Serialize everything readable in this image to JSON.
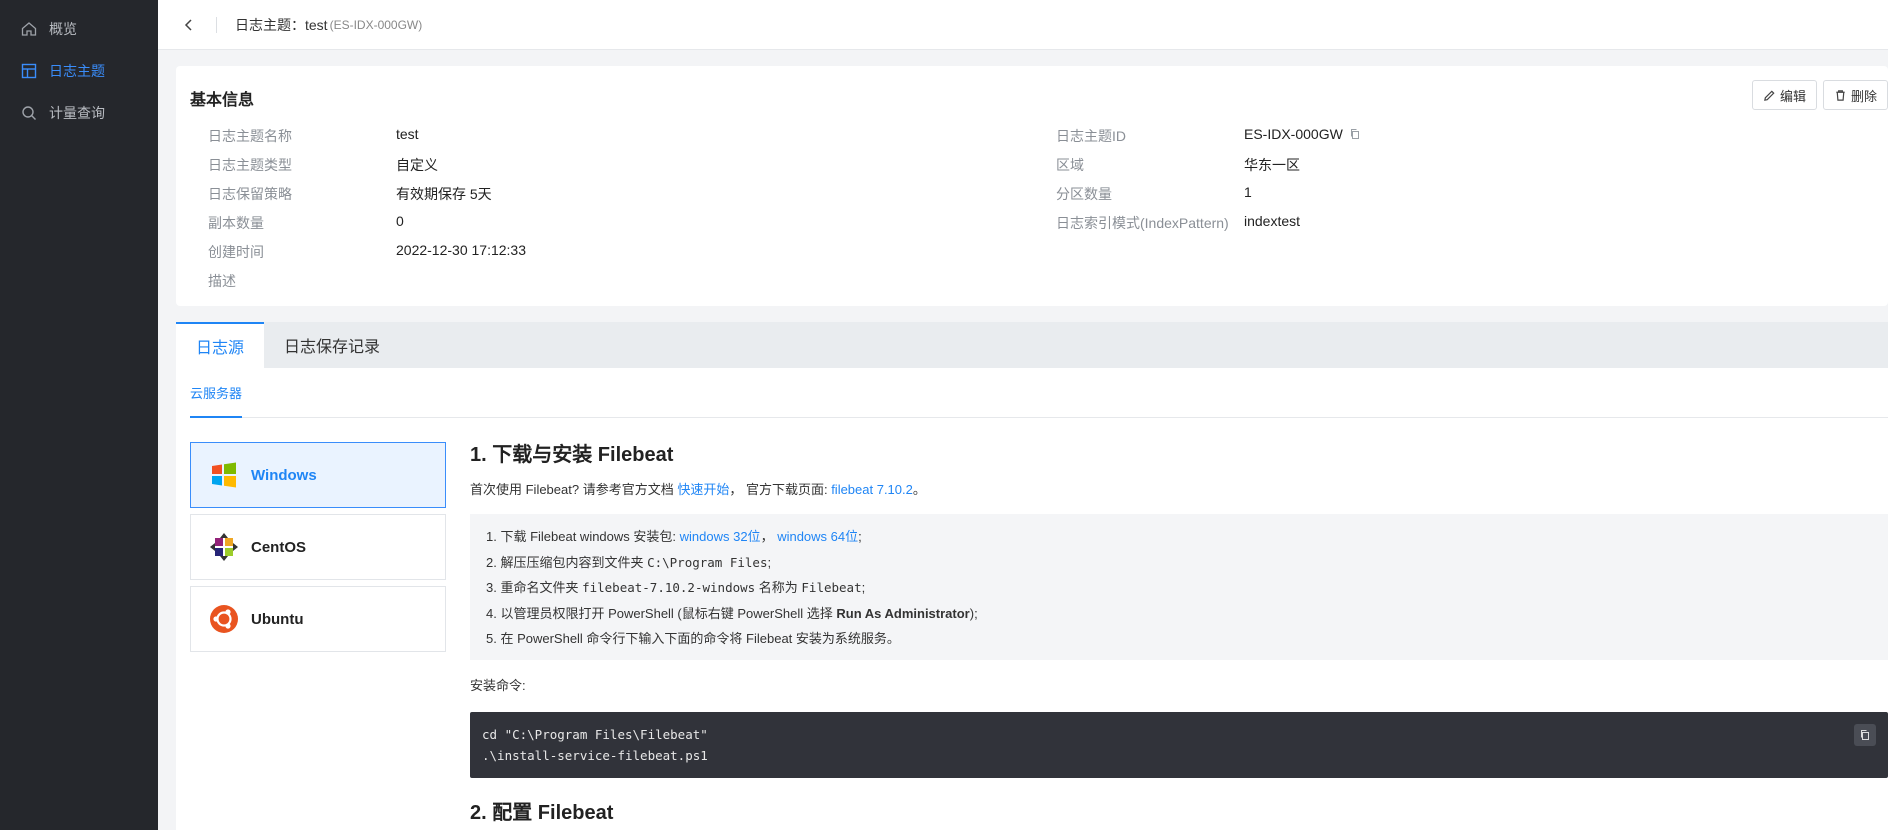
{
  "sidebar": {
    "items": [
      {
        "label": "概览",
        "icon": "home-icon"
      },
      {
        "label": "日志主题",
        "icon": "layout-icon"
      },
      {
        "label": "计量查询",
        "icon": "search-icon"
      }
    ]
  },
  "header": {
    "title": "日志主题：test",
    "subtitle": "(ES-IDX-000GW)"
  },
  "basic": {
    "title": "基本信息",
    "edit_label": "编辑",
    "delete_label": "删除",
    "left": [
      {
        "label": "日志主题名称",
        "value": "test"
      },
      {
        "label": "日志主题类型",
        "value": "自定义"
      },
      {
        "label": "日志保留策略",
        "value": "有效期保存 5天"
      },
      {
        "label": "副本数量",
        "value": "0"
      },
      {
        "label": "创建时间",
        "value": "2022-12-30 17:12:33"
      },
      {
        "label": "描述",
        "value": ""
      }
    ],
    "right": [
      {
        "label": "日志主题ID",
        "value": "ES-IDX-000GW"
      },
      {
        "label": "区域",
        "value": "华东一区"
      },
      {
        "label": "分区数量",
        "value": "1"
      },
      {
        "label": "日志索引模式(IndexPattern)",
        "value": "indextest"
      }
    ]
  },
  "tabs": [
    "日志源",
    "日志保存记录"
  ],
  "subtab": "云服务器",
  "os_list": [
    "Windows",
    "CentOS",
    "Ubuntu"
  ],
  "section1": {
    "title": "1. 下载与安装 Filebeat",
    "intro_prefix": "首次使用 Filebeat? 请参考官方文档 ",
    "intro_link1": "快速开始",
    "intro_mid": "， 官方下载页面: ",
    "intro_link2": "filebeat 7.10.2",
    "intro_suffix": "。",
    "steps": {
      "s1_prefix": "1. 下载 Filebeat windows 安装包: ",
      "s1_link1": "windows 32位",
      "s1_sep": "， ",
      "s1_link2": "windows 64位",
      "s1_suffix": ";",
      "s2_prefix": "2. 解压压缩包内容到文件夹 ",
      "s2_code": "C:\\Program Files",
      "s2_suffix": ";",
      "s3_prefix": "3. 重命名文件夹 ",
      "s3_code1": "filebeat-7.10.2-windows",
      "s3_mid": " 名称为 ",
      "s3_code2": "Filebeat",
      "s3_suffix": ";",
      "s4_prefix": "4. 以管理员权限打开 PowerShell (鼠标右键 PowerShell 选择 ",
      "s4_bold": "Run As Administrator",
      "s4_suffix": ");",
      "s5": "5. 在 PowerShell 命令行下输入下面的命令将 Filebeat 安装为系统服务。"
    },
    "install_label": "安装命令:",
    "code": [
      "cd \"C:\\Program Files\\Filebeat\"",
      ".\\install-service-filebeat.ps1"
    ]
  },
  "section2": {
    "title": "2. 配置 Filebeat"
  },
  "colors": {
    "accent": "#1f85f5",
    "sidebar_bg": "#25272c",
    "code_bg": "#31333a"
  }
}
